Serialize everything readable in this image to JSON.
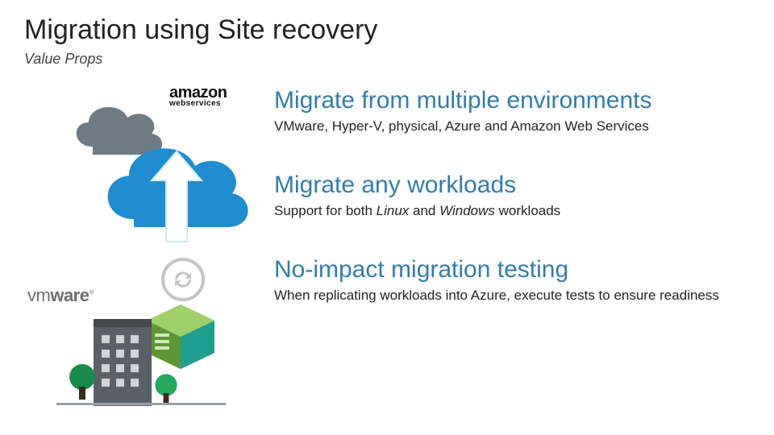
{
  "title": "Migration using Site recovery",
  "subtitle": "Value Props",
  "logos": {
    "aws_top": "amazon",
    "aws_bottom": "webservices",
    "vmware_prefix": "vm",
    "vmware_suffix": "ware",
    "vmware_reg": "®"
  },
  "sections": [
    {
      "heading": "Migrate from multiple environments",
      "body_plain": "VMware, Hyper-V, physical, Azure and Amazon Web Services"
    },
    {
      "heading": "Migrate any workloads",
      "body_prefix": "Support for both ",
      "body_em1": "Linux",
      "body_mid": " and ",
      "body_em2": "Windows",
      "body_suffix": " workloads"
    },
    {
      "heading": "No-impact migration testing",
      "body_plain": "When replicating workloads into Azure, execute tests to ensure readiness"
    }
  ],
  "icons": {
    "cloud_grey": "cloud-icon",
    "cloud_blue": "cloud-icon",
    "upload_arrow": "upload-arrow-icon",
    "sync": "sync-icon",
    "server": "server-icon",
    "building": "building-icon",
    "tree": "tree-icon"
  },
  "colors": {
    "heading": "#2f7ea8",
    "cloud_grey": "#6f7b82",
    "cloud_blue": "#1f8dcf",
    "server_green": "#7ab642",
    "server_teal": "#1e9f8f",
    "building": "#5a6067"
  }
}
